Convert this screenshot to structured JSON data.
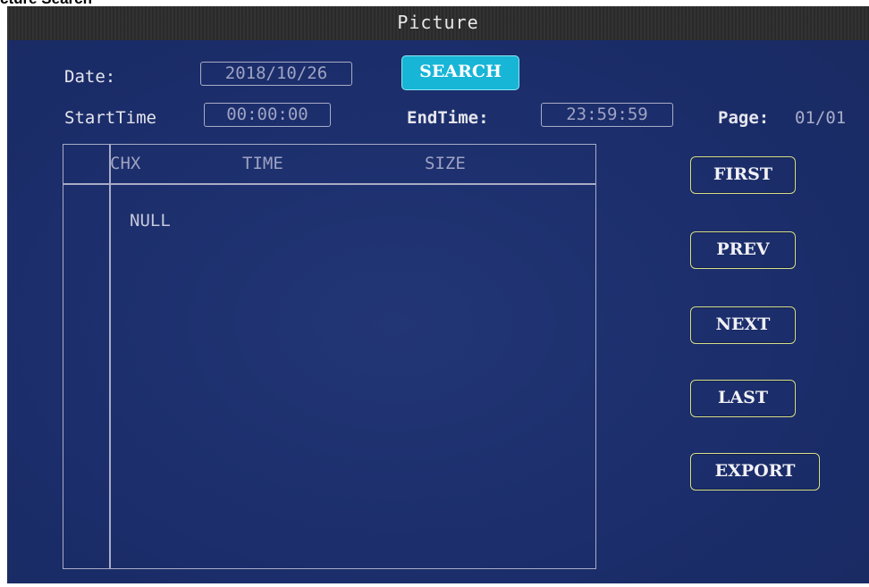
{
  "caption": "cture Search",
  "window": {
    "title": "Picture"
  },
  "form": {
    "date_label": "Date:",
    "date_value": "2018/10/26",
    "search_label": "SEARCH",
    "start_label": "StartTime",
    "start_value": "00:00:00",
    "end_label": "EndTime:",
    "end_value": "23:59:59",
    "page_label": "Page:",
    "page_value": "01/01"
  },
  "list": {
    "columns": [
      "CHX",
      "TIME",
      "SIZE"
    ],
    "empty_text": "NULL"
  },
  "buttons": {
    "first": "FIRST",
    "prev": "PREV",
    "next": "NEXT",
    "last": "LAST",
    "export": "EXPORT"
  },
  "colors": {
    "background": "#1b2d6a",
    "accent": "#17b5d6",
    "button_border": "#d7e08c"
  }
}
